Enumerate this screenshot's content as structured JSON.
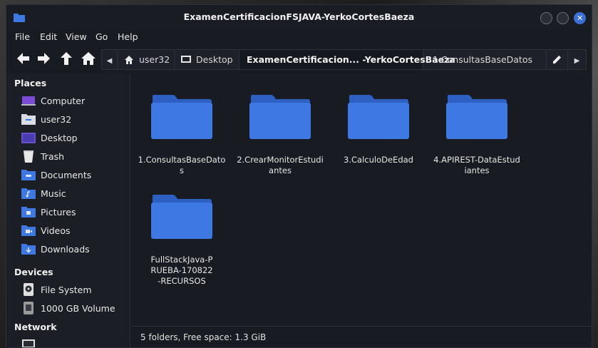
{
  "window": {
    "title": "ExamenCertificacionFSJAVA-YerkoCortesBaeza"
  },
  "menu": [
    "File",
    "Edit",
    "View",
    "Go",
    "Help"
  ],
  "pathbar": {
    "crumbs": [
      "user32",
      "Desktop",
      "ExamenCertificacion... -YerkoCortesBaeza",
      "1.ConsultasBaseDatos"
    ]
  },
  "sidebar": {
    "places_header": "Places",
    "places": [
      "Computer",
      "user32",
      "Desktop",
      "Trash",
      "Documents",
      "Music",
      "Pictures",
      "Videos",
      "Downloads"
    ],
    "devices_header": "Devices",
    "devices": [
      "File System",
      "1000 GB Volume"
    ],
    "network_header": "Network"
  },
  "folders": [
    "1.ConsultasBaseDatos",
    "2.CrearMonitorEstudiantes",
    "3.CalculoDeEdad",
    "4.APIREST-DataEstudiantes",
    "FullStackJava-PRUEBA-170822-RECURSOS"
  ],
  "status": "5 folders, Free space: 1.3 GiB",
  "colors": {
    "accent": "#3a6fd8",
    "folder": "#3d78e3",
    "folder_tab": "#2e60c4",
    "background": "#181b22"
  }
}
